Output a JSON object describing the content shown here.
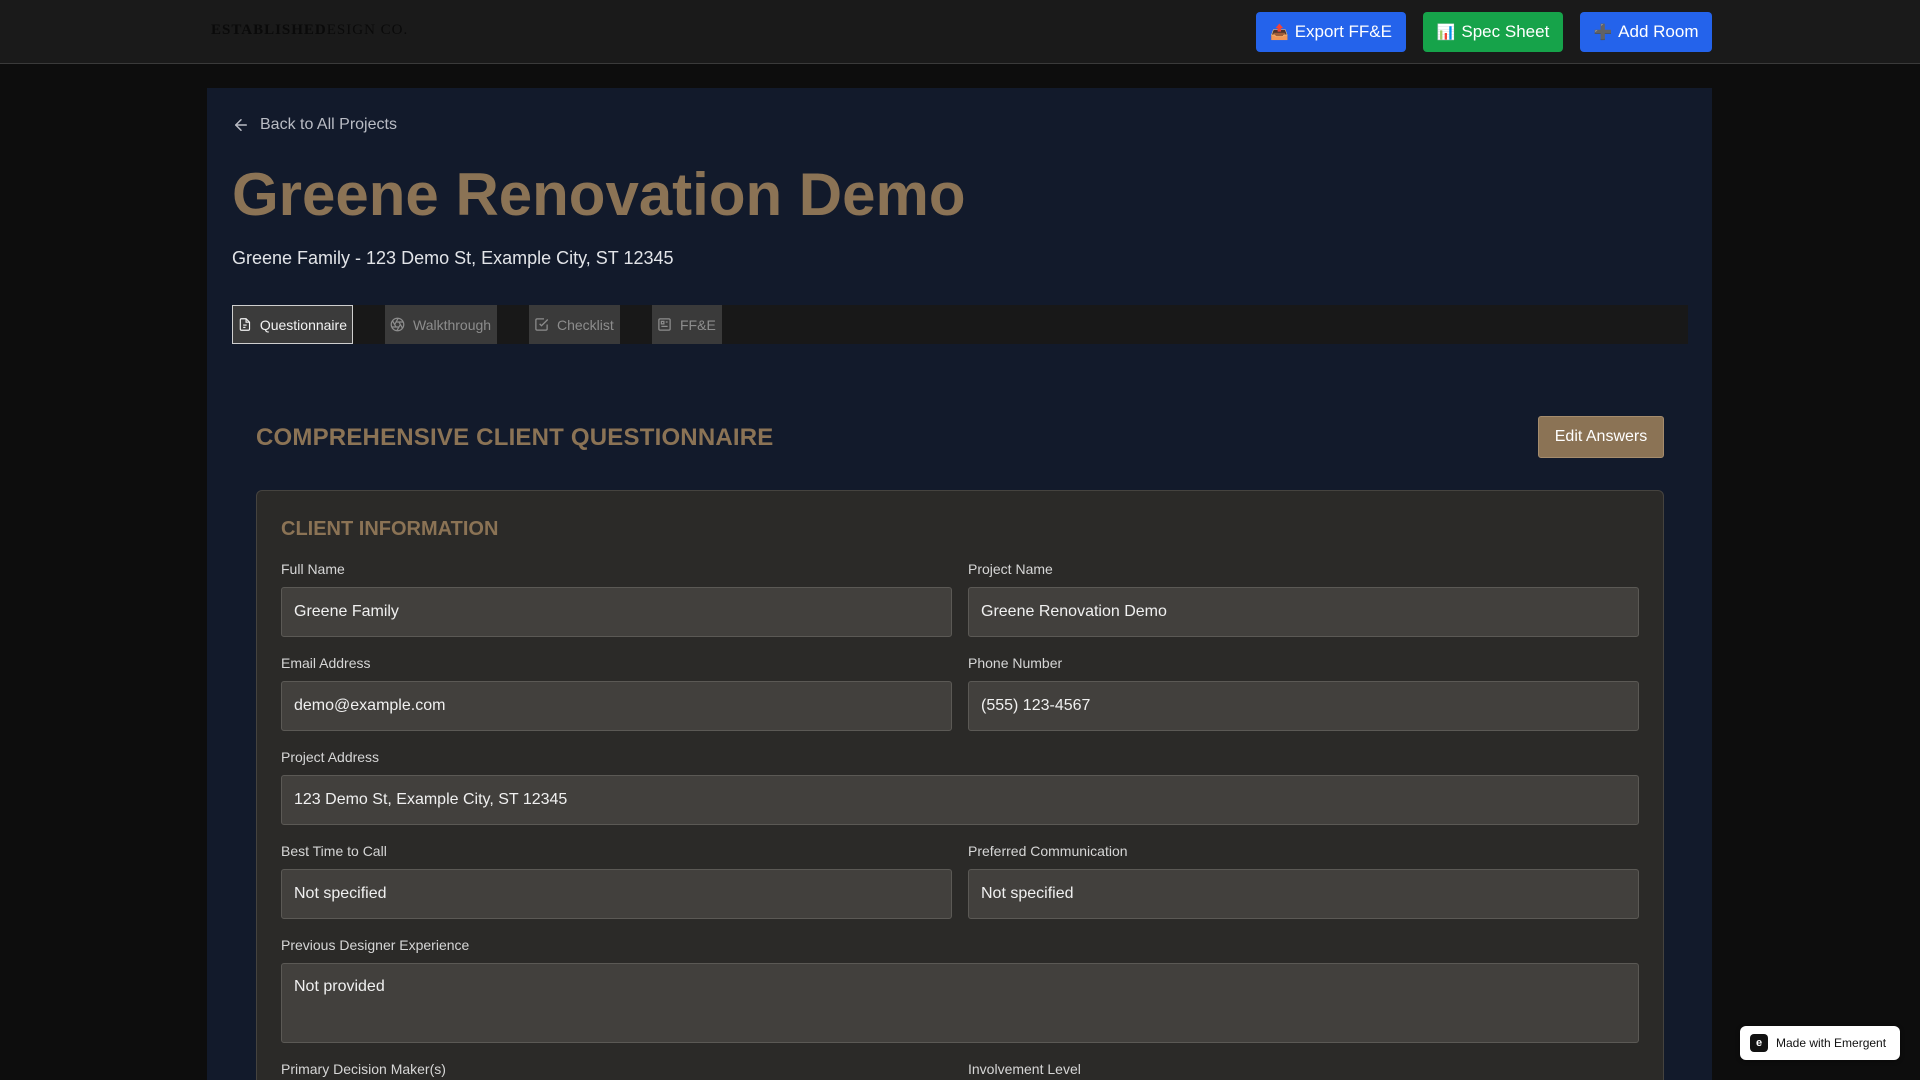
{
  "header": {
    "logo_bold": "ESTABLISHED",
    "logo_rest": "ESIGN CO.",
    "export_icon": "📤",
    "export_label": "Export FF&E",
    "spec_icon": "📊",
    "spec_label": "Spec Sheet",
    "add_icon": "➕",
    "add_label": "Add Room",
    "colors": {
      "export": "#2463eb",
      "spec": "#16a34a",
      "add": "#2463eb"
    }
  },
  "project": {
    "back_label": "Back to All Projects",
    "title": "Greene Renovation Demo",
    "subtitle": "Greene Family - 123 Demo St, Example City, ST 12345",
    "accent_color": "#8b7355"
  },
  "tabs": [
    {
      "label": "Questionnaire",
      "icon": "document-icon",
      "active": true
    },
    {
      "label": "Walkthrough",
      "icon": "aperture-icon",
      "active": false
    },
    {
      "label": "Checklist",
      "icon": "checkbox-icon",
      "active": false
    },
    {
      "label": "FF&E",
      "icon": "clipboard-icon",
      "active": false
    }
  ],
  "questionnaire": {
    "title": "COMPREHENSIVE CLIENT QUESTIONNAIRE",
    "edit_label": "Edit Answers",
    "section_title": "CLIENT INFORMATION",
    "fields": {
      "full_name": {
        "label": "Full Name",
        "value": "Greene Family"
      },
      "project_name": {
        "label": "Project Name",
        "value": "Greene Renovation Demo"
      },
      "email": {
        "label": "Email Address",
        "value": "demo@example.com"
      },
      "phone": {
        "label": "Phone Number",
        "value": "(555) 123-4567"
      },
      "address": {
        "label": "Project Address",
        "value": "123 Demo St, Example City, ST 12345"
      },
      "best_time": {
        "label": "Best Time to Call",
        "value": "Not specified"
      },
      "communication": {
        "label": "Preferred Communication",
        "value": "Not specified"
      },
      "previous_designer": {
        "label": "Previous Designer Experience",
        "value": "Not provided"
      },
      "decision_maker": {
        "label": "Primary Decision Maker(s)"
      },
      "involvement": {
        "label": "Involvement Level"
      }
    }
  },
  "badge": {
    "label": "Made with Emergent"
  }
}
